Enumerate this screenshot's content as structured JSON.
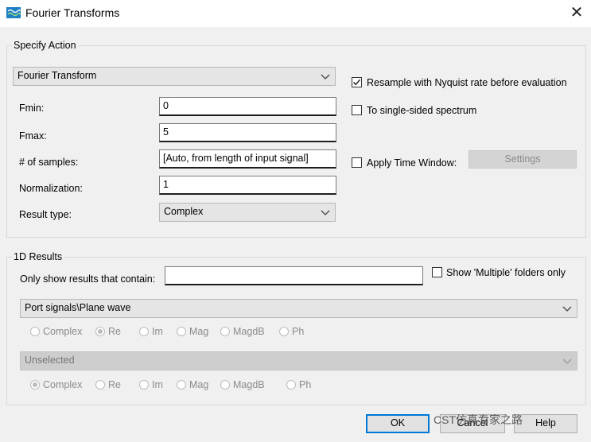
{
  "window": {
    "title": "Fourier Transforms",
    "close_glyph": "✕"
  },
  "specify_action": {
    "group_label": "Specify Action",
    "action_select": "Fourier Transform",
    "fields": {
      "fmin_label": "Fmin:",
      "fmin_value": "0",
      "fmax_label": "Fmax:",
      "fmax_value": "5",
      "samples_label": "# of samples:",
      "samples_value": "[Auto, from length of input signal]",
      "normalization_label": "Normalization:",
      "normalization_value": "1",
      "result_type_label": "Result type:",
      "result_type_value": "Complex"
    },
    "options": {
      "resample_label": "Resample with Nyquist rate before evaluation",
      "resample_checked": true,
      "single_sided_label": "To single-sided spectrum",
      "single_sided_checked": false,
      "time_window_label": "Apply Time Window:",
      "time_window_checked": false,
      "settings_label": "Settings"
    }
  },
  "results_1d": {
    "group_label": "1D Results",
    "filter_label": "Only show results that contain:",
    "filter_value": "",
    "multiple_only_label": "Show 'Multiple' folders only",
    "multiple_only_checked": false,
    "signal1": {
      "select": "Port signals\\Plane wave",
      "radios": [
        "Complex",
        "Re",
        "Im",
        "Mag",
        "MagdB",
        "Ph"
      ],
      "selected": "Re"
    },
    "signal2": {
      "select": "Unselected",
      "radios": [
        "Complex",
        "Re",
        "Im",
        "Mag",
        "MagdB",
        "Ph"
      ],
      "selected": "Complex"
    }
  },
  "footer": {
    "ok_label": "OK",
    "cancel_label": "Cancel",
    "help_label": "Help",
    "watermark": "CST仿真专家之路"
  }
}
